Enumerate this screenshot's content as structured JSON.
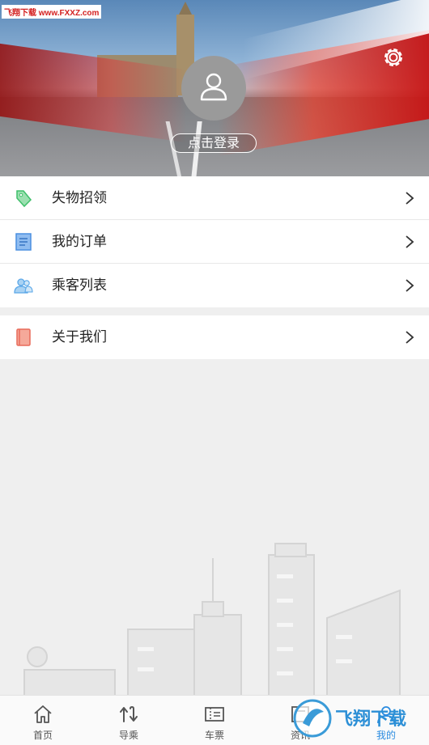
{
  "watermark": "飞翔下载 www.FXXZ.com",
  "profile": {
    "login_label": "点击登录"
  },
  "menu_group_1": [
    {
      "label": "失物招领",
      "icon": "tag-icon"
    },
    {
      "label": "我的订单",
      "icon": "order-icon"
    },
    {
      "label": "乘客列表",
      "icon": "passengers-icon"
    }
  ],
  "menu_group_2": [
    {
      "label": "关于我们",
      "icon": "book-icon"
    }
  ],
  "tabs": [
    {
      "label": "首页",
      "icon": "home-icon",
      "active": false
    },
    {
      "label": "导乘",
      "icon": "guide-icon",
      "active": false
    },
    {
      "label": "车票",
      "icon": "ticket-icon",
      "active": false
    },
    {
      "label": "资讯",
      "icon": "news-icon",
      "active": false
    },
    {
      "label": "我的",
      "icon": "profile-icon",
      "active": true
    }
  ],
  "brand_watermark": "飞翔下载",
  "colors": {
    "accent": "#2a8be0",
    "tag_green": "#3fbf6a",
    "order_blue": "#4a8fe0",
    "passenger_blue": "#5aa7e8",
    "book_red": "#e86b5a"
  }
}
